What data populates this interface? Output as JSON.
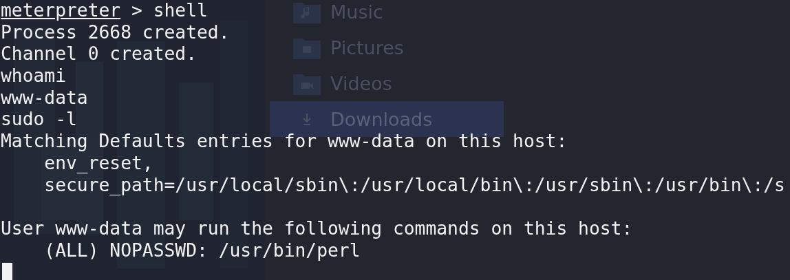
{
  "background_sidebar": {
    "entries": [
      {
        "label": "Music",
        "selected": false
      },
      {
        "label": "Pictures",
        "selected": false
      },
      {
        "label": "Videos",
        "selected": false
      },
      {
        "label": "Downloads",
        "selected": true
      }
    ]
  },
  "terminal": {
    "prompt": {
      "name": "meterpreter",
      "command": " > shell"
    },
    "blocks": [
      [
        "Process 2668 created.",
        "Channel 0 created.",
        "whoami",
        "www-data",
        "sudo -l",
        "Matching Defaults entries for www-data on this host:",
        "    env_reset,",
        "    secure_path=/usr/local/sbin\\:/usr/local/bin\\:/usr/sbin\\:/usr/bin\\:/s"
      ],
      [
        "User www-data may run the following commands on this host:",
        "    (ALL) NOPASSWD: /usr/bin/perl"
      ]
    ],
    "cursor": true
  }
}
